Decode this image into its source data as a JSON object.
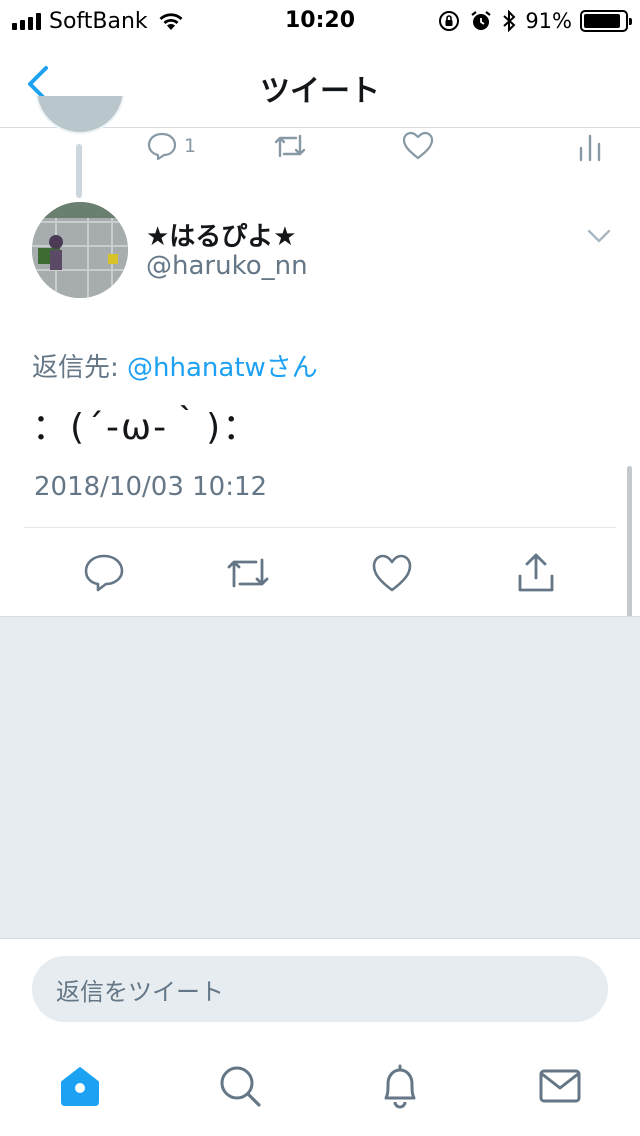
{
  "status_bar": {
    "carrier": "SoftBank",
    "time": "10:20",
    "battery_percent": "91%",
    "battery_level": 0.91
  },
  "nav": {
    "title": "ツイート",
    "back_icon": "chevron-left-icon"
  },
  "previous_tweet": {
    "reply_count": "1"
  },
  "tweet": {
    "author_name": "★はるぴよ★",
    "author_handle": "@haruko_nn",
    "reply_to_label": "返信先: ",
    "reply_to_mention": "@hhanatwさん",
    "text": "：(´-ω-｀)：",
    "timestamp": "2018/10/03 10:12"
  },
  "reply_box": {
    "placeholder": "返信をツイート"
  },
  "tab_bar": {
    "items": [
      "home-icon",
      "search-icon",
      "notifications-icon",
      "messages-icon"
    ],
    "active": "home-icon"
  },
  "colors": {
    "accent": "#1da1f2",
    "secondary_text": "#657786",
    "icon_gray": "#657786",
    "background_gray": "#e6ecf0"
  }
}
